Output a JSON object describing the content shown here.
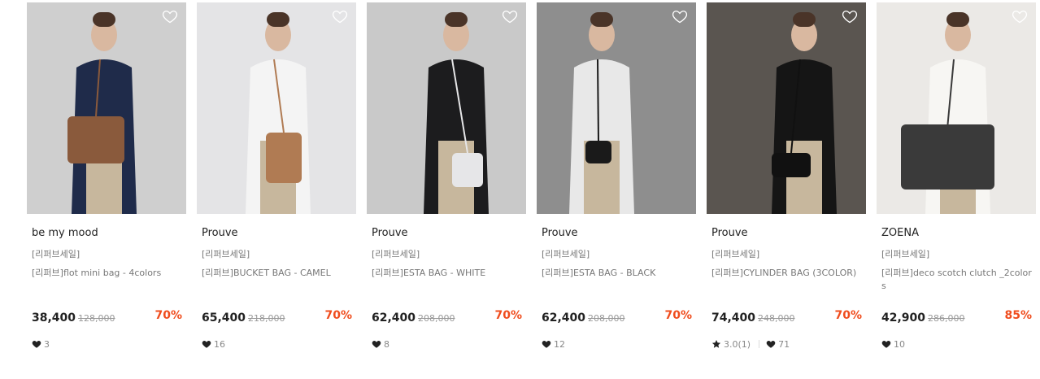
{
  "products": [
    {
      "brand": "be my mood",
      "category": "[리퍼브세일]",
      "name": "[리퍼브]flot mini bag - 4colors",
      "price": "38,400",
      "original_price": "128,000",
      "discount": "70%",
      "rating": null,
      "likes": "3",
      "photo": {
        "bg": "#cfcfcf",
        "accent": "#1f2b4a",
        "item": "#8a5a3c"
      }
    },
    {
      "brand": "Prouve",
      "category": "[리퍼브세일]",
      "name": "[리퍼브]BUCKET BAG - CAMEL",
      "price": "65,400",
      "original_price": "218,000",
      "discount": "70%",
      "rating": null,
      "likes": "16",
      "photo": {
        "bg": "#e4e4e6",
        "accent": "#f4f4f4",
        "item": "#b07b53"
      }
    },
    {
      "brand": "Prouve",
      "category": "[리퍼브세일]",
      "name": "[리퍼브]ESTA BAG - WHITE",
      "price": "62,400",
      "original_price": "208,000",
      "discount": "70%",
      "rating": null,
      "likes": "8",
      "photo": {
        "bg": "#c9c9c9",
        "accent": "#1c1c1e",
        "item": "#e6e6e8"
      }
    },
    {
      "brand": "Prouve",
      "category": "[리퍼브세일]",
      "name": "[리퍼브]ESTA BAG - BLACK",
      "price": "62,400",
      "original_price": "208,000",
      "discount": "70%",
      "rating": null,
      "likes": "12",
      "photo": {
        "bg": "#8e8e8e",
        "accent": "#e8e8e8",
        "item": "#1a1a1a"
      }
    },
    {
      "brand": "Prouve",
      "category": "[리퍼브세일]",
      "name": "[리퍼브]CYLINDER BAG (3COLOR)",
      "price": "74,400",
      "original_price": "248,000",
      "discount": "70%",
      "rating": "3.0(1)",
      "likes": "71",
      "photo": {
        "bg": "#5a5550",
        "accent": "#151515",
        "item": "#111111"
      }
    },
    {
      "brand": "ZOENA",
      "category": "[리퍼브세일]",
      "name": "[리퍼브]deco scotch clutch _2colors",
      "price": "42,900",
      "original_price": "286,000",
      "discount": "85%",
      "rating": null,
      "likes": "10",
      "photo": {
        "bg": "#ebe9e6",
        "accent": "#f7f6f3",
        "item": "#3a3a3a"
      }
    }
  ],
  "icons": {
    "wishlist": "heart-outline-icon",
    "likes": "heart-icon",
    "rating": "star-icon"
  },
  "colors": {
    "discount": "#f04d1e",
    "text": "#222222",
    "muted": "#777777"
  }
}
